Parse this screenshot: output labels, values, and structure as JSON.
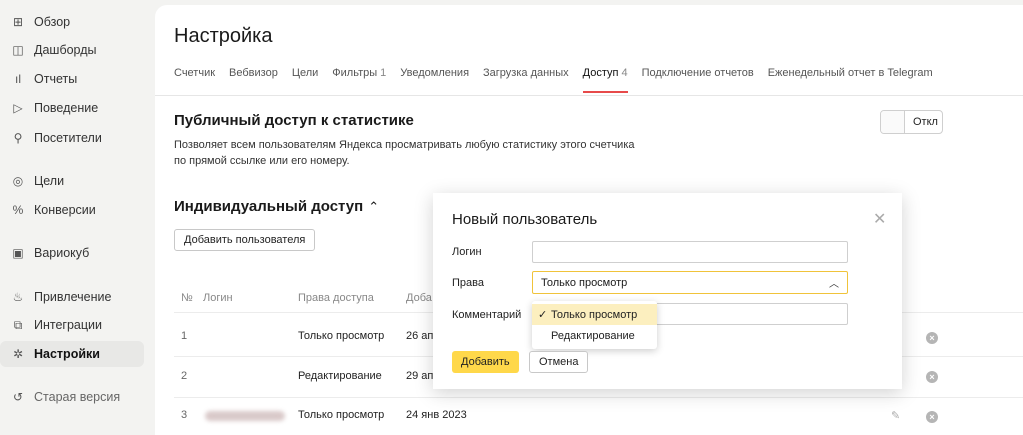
{
  "sidebar": {
    "items": [
      {
        "icon": "grid-icon",
        "glyph": "⊞",
        "label": "Обзор"
      },
      {
        "icon": "dashboard-icon",
        "glyph": "◫",
        "label": "Дашборды"
      },
      {
        "icon": "reports-icon",
        "glyph": "ıl",
        "label": "Отчеты"
      },
      {
        "icon": "play-icon",
        "glyph": "▷",
        "label": "Поведение"
      },
      {
        "icon": "user-icon",
        "glyph": "⚲",
        "label": "Посетители"
      },
      {
        "icon": "target-icon",
        "glyph": "◎",
        "label": "Цели"
      },
      {
        "icon": "percent-icon",
        "glyph": "%",
        "label": "Конверсии"
      },
      {
        "icon": "cube-icon",
        "glyph": "▣",
        "label": "Вариокуб"
      },
      {
        "icon": "flame-icon",
        "glyph": "♨",
        "label": "Привлечение"
      },
      {
        "icon": "puzzle-icon",
        "glyph": "⧉",
        "label": "Интеграции"
      },
      {
        "icon": "gear-icon",
        "glyph": "✲",
        "label": "Настройки"
      },
      {
        "icon": "back-icon",
        "glyph": "↺",
        "label": "Старая версия"
      }
    ]
  },
  "page": {
    "title": "Настройка"
  },
  "tabs": [
    {
      "label": "Счетчик",
      "count": ""
    },
    {
      "label": "Вебвизор",
      "count": ""
    },
    {
      "label": "Цели",
      "count": ""
    },
    {
      "label": "Фильтры",
      "count": "1"
    },
    {
      "label": "Уведомления",
      "count": ""
    },
    {
      "label": "Загрузка данных",
      "count": ""
    },
    {
      "label": "Доступ",
      "count": "4"
    },
    {
      "label": "Подключение отчетов",
      "count": ""
    },
    {
      "label": "Еженедельный отчет в Telegram",
      "count": ""
    }
  ],
  "public_access": {
    "title": "Публичный доступ к статистике",
    "description": "Позволяет всем пользователям Яндекса просматривать любую статистику этого счетчика по прямой ссылке или его номеру.",
    "toggle_label": "Откл"
  },
  "individual_access": {
    "title": "Индивидуальный доступ",
    "chevron": "⌃",
    "add_user_label": "Добавить пользователя"
  },
  "table": {
    "headers": {
      "num": "№",
      "login": "Логин",
      "rights": "Права доступа",
      "date": "Доба"
    },
    "rows": [
      {
        "num": "1",
        "rights": "Только просмотр",
        "date": "26 ап"
      },
      {
        "num": "2",
        "rights": "Редактирование",
        "date": "29 ап"
      },
      {
        "num": "3",
        "rights": "Только просмотр",
        "date": "24 янв 2023"
      }
    ]
  },
  "modal": {
    "title": "Новый пользователь",
    "close_glyph": "✕",
    "login_label": "Логин",
    "login_value": "",
    "rights_label": "Права",
    "rights_value": "Только просмотр",
    "comment_label": "Комментарий",
    "comment_value": "",
    "options": [
      {
        "label": "Только просмотр",
        "check": "✓",
        "selected": true
      },
      {
        "label": "Редактирование",
        "check": "",
        "selected": false
      }
    ],
    "submit_label": "Добавить",
    "cancel_label": "Отмена"
  }
}
